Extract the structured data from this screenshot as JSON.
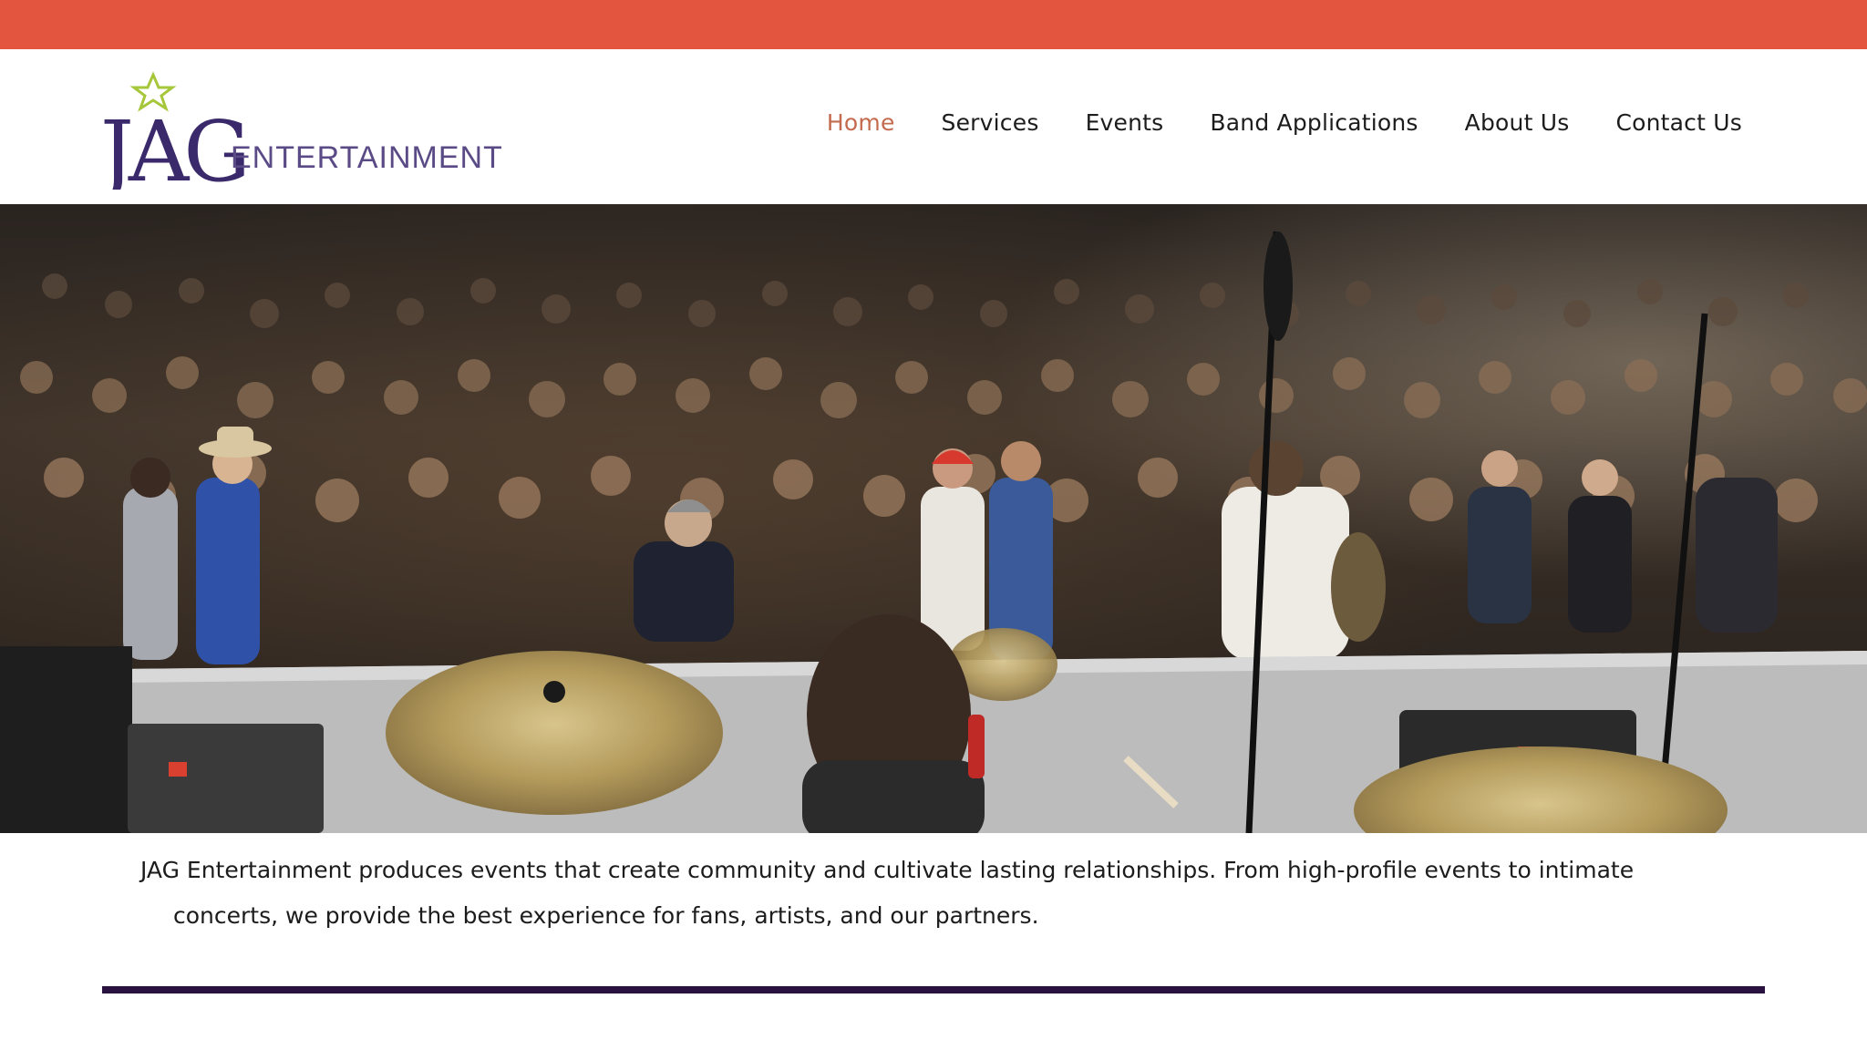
{
  "brand": {
    "logo_main": "JAG",
    "logo_sub": "ENTERTAINMENT"
  },
  "nav": {
    "items": [
      {
        "label": "Home",
        "active": true
      },
      {
        "label": "Services",
        "active": false
      },
      {
        "label": "Events",
        "active": false
      },
      {
        "label": "Band Applications",
        "active": false
      },
      {
        "label": "About Us",
        "active": false
      },
      {
        "label": "Contact Us",
        "active": false
      }
    ]
  },
  "intro": {
    "line1": "JAG Entertainment produces events that create community and cultivate lasting relationships. From high-profile events to intimate",
    "line2": "concerts, we provide the best experience for fans, artists, and our partners."
  },
  "colors": {
    "top_bar": "#e3553e",
    "nav_active": "#c46a4e",
    "nav_text": "#1c1c1c",
    "logo_purple": "#3b2a6b",
    "logo_text": "#5a4a86",
    "logo_star": "#a6c73a",
    "divider": "#2a1240"
  }
}
